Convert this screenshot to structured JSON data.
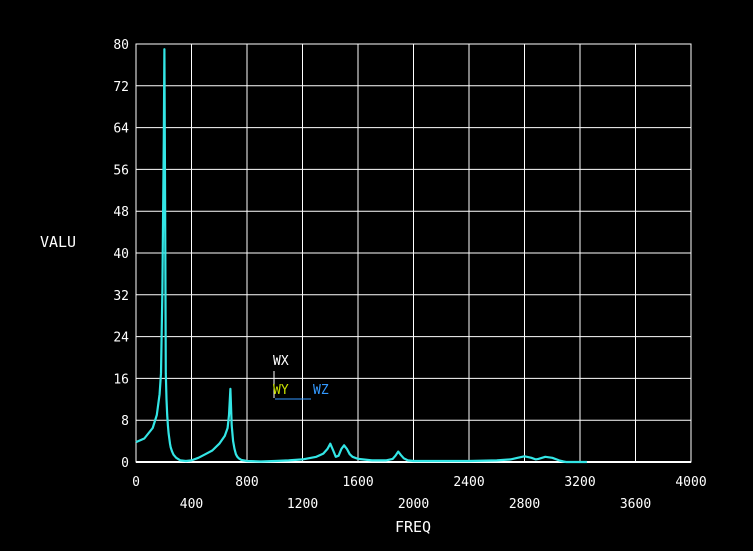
{
  "chart_data": {
    "type": "line",
    "xlabel": "FREQ",
    "ylabel": "VALU",
    "xlim": [
      0,
      4000
    ],
    "ylim": [
      0,
      80
    ],
    "x_ticks": [
      0,
      400,
      800,
      1200,
      1600,
      2000,
      2400,
      2800,
      3200,
      3600,
      4000
    ],
    "y_ticks": [
      0,
      8,
      16,
      24,
      32,
      40,
      48,
      56,
      64,
      72,
      80
    ],
    "grid": true,
    "background": "#000000",
    "axis_color": "#ffffff",
    "grid_color": "#ffffff",
    "legend": {
      "placement": "center-left",
      "entries": [
        {
          "name": "WX",
          "color": "#ffffff"
        },
        {
          "name": "WY",
          "color": "#c8e000"
        },
        {
          "name": "WZ",
          "color": "#3399ff"
        }
      ]
    },
    "series": [
      {
        "color": "#33e6e6",
        "x": [
          0,
          60,
          120,
          150,
          170,
          180,
          190,
          200,
          205,
          210,
          215,
          220,
          225,
          230,
          235,
          240,
          245,
          250,
          260,
          270,
          290,
          320,
          360,
          400,
          450,
          500,
          550,
          600,
          640,
          660,
          670,
          680,
          690,
          700,
          710,
          720,
          730,
          740,
          760,
          800,
          900,
          1000,
          1100,
          1200,
          1300,
          1350,
          1380,
          1400,
          1420,
          1440,
          1460,
          1480,
          1500,
          1520,
          1540,
          1560,
          1600,
          1700,
          1800,
          1850,
          1870,
          1890,
          1910,
          1930,
          1960,
          2000,
          2200,
          2400,
          2600,
          2700,
          2750,
          2800,
          2850,
          2880,
          2900,
          2950,
          3000,
          3050,
          3080,
          3100,
          3150,
          3200,
          3250
        ],
        "y": [
          3.8,
          4.5,
          6.5,
          9,
          13,
          17,
          33,
          62,
          79,
          50,
          17,
          12,
          9,
          7,
          5.5,
          4.5,
          3.5,
          2.8,
          2,
          1.4,
          0.8,
          0.3,
          0.2,
          0.3,
          0.8,
          1.5,
          2.2,
          3.5,
          5,
          6.5,
          9,
          14,
          7,
          4,
          2.5,
          1.5,
          1,
          0.7,
          0.4,
          0.2,
          0.1,
          0.2,
          0.3,
          0.5,
          1,
          1.6,
          2.5,
          3.5,
          2.3,
          1,
          1.2,
          2.5,
          3.2,
          2.5,
          1.5,
          1,
          0.6,
          0.3,
          0.3,
          0.6,
          1.2,
          2,
          1.3,
          0.7,
          0.3,
          0.2,
          0.2,
          0.2,
          0.3,
          0.5,
          0.8,
          1.1,
          0.8,
          0.5,
          0.6,
          1,
          0.8,
          0.3,
          0.1,
          0,
          0,
          0,
          0
        ]
      }
    ]
  }
}
